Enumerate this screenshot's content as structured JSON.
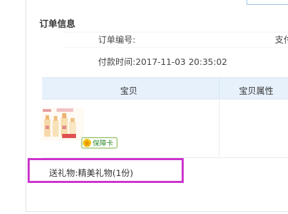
{
  "order": {
    "section_title": "订单信息",
    "order_no_label": "订单编号:",
    "pay_label_partial": "支付",
    "paid_time_label": "付款时间:",
    "paid_time_value": "2017-11-03 20:35:02"
  },
  "table": {
    "columns": [
      "宝贝",
      "宝贝属性"
    ]
  },
  "item": {
    "badge_label": "保障卡"
  },
  "gift": {
    "text": "送礼物:精美礼物(1份)"
  },
  "colors": {
    "highlight": "#cc33cc",
    "table_header": "#e7f1fb",
    "badge_green": "#2e8b2e"
  }
}
